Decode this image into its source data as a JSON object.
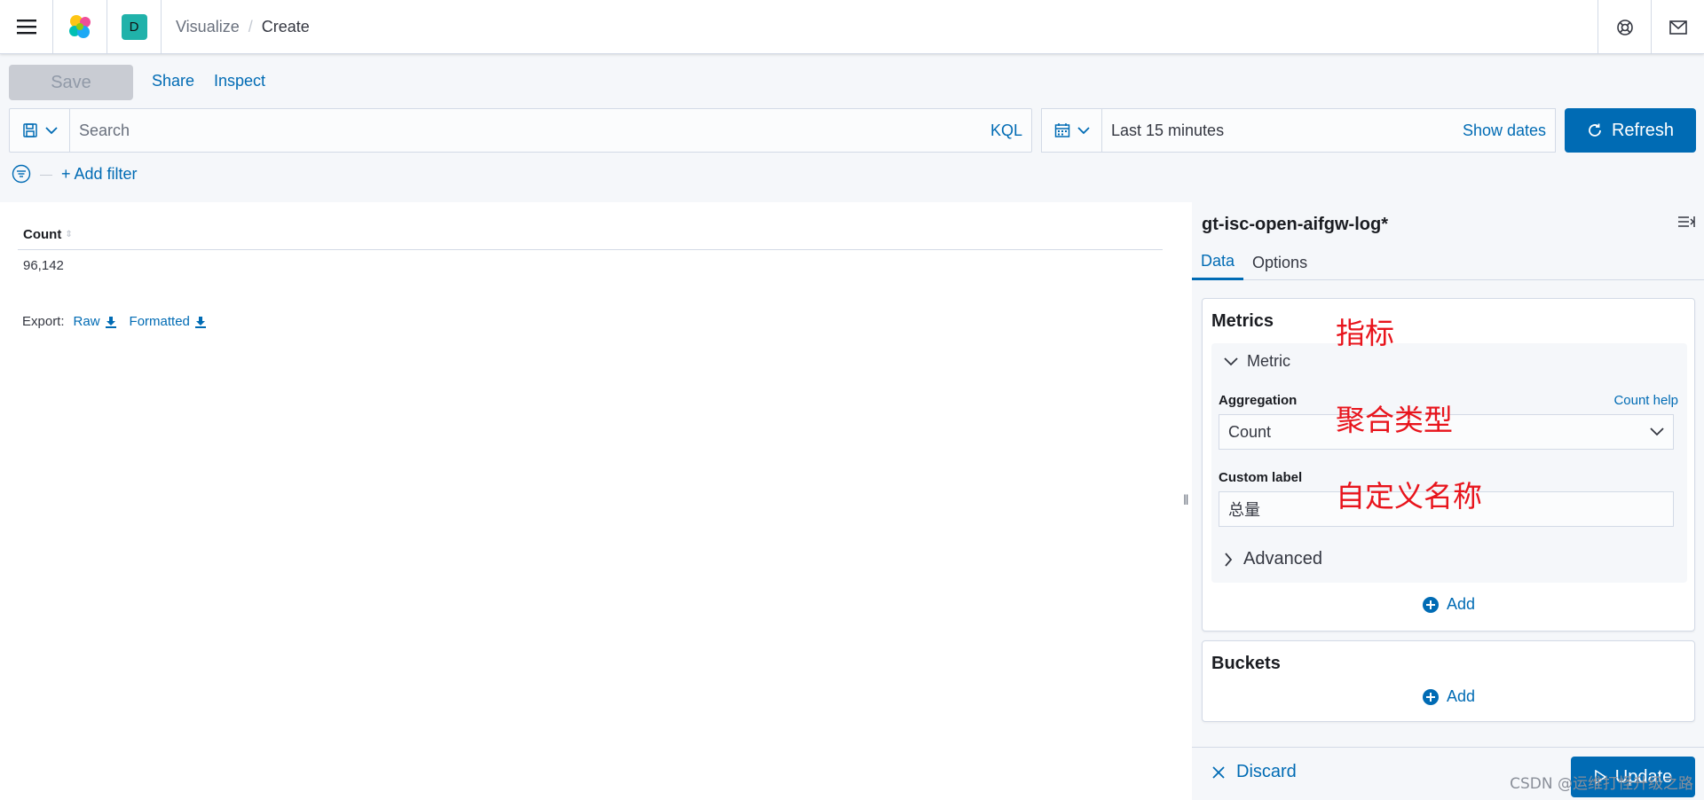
{
  "header": {
    "avatar_letter": "D",
    "breadcrumbs": [
      "Visualize",
      "Create"
    ],
    "breadcrumb_separator": "/"
  },
  "toolbar": {
    "save_label": "Save",
    "share_label": "Share",
    "inspect_label": "Inspect"
  },
  "query": {
    "placeholder": "Search",
    "language": "KQL"
  },
  "time": {
    "range": "Last 15 minutes",
    "show_dates": "Show dates",
    "refresh_label": "Refresh"
  },
  "filters": {
    "add_filter": "+ Add filter"
  },
  "table": {
    "column": "Count",
    "rows": [
      "96,142"
    ]
  },
  "export": {
    "label": "Export:",
    "raw": "Raw",
    "formatted": "Formatted"
  },
  "sidebar": {
    "index_pattern": "gt-isc-open-aifgw-log*",
    "tabs": [
      "Data",
      "Options"
    ],
    "active_tab": "Data",
    "metrics": {
      "title": "Metrics",
      "agg_title": "Metric",
      "aggregation_label": "Aggregation",
      "aggregation_help": "Count help",
      "aggregation_value": "Count",
      "custom_label_label": "Custom label",
      "custom_label_value": "总量",
      "advanced": "Advanced",
      "add": "Add"
    },
    "buckets": {
      "title": "Buckets",
      "add": "Add"
    },
    "discard": "Discard",
    "update": "Update"
  },
  "annotations": {
    "metric": "指标",
    "aggregation": "聚合类型",
    "custom_label": "自定义名称"
  },
  "watermark": "CSDN @运维打怪升级之路",
  "colors": {
    "accent": "#006bb4",
    "annotation": "#e8141c",
    "avatar": "#20b2aa"
  }
}
